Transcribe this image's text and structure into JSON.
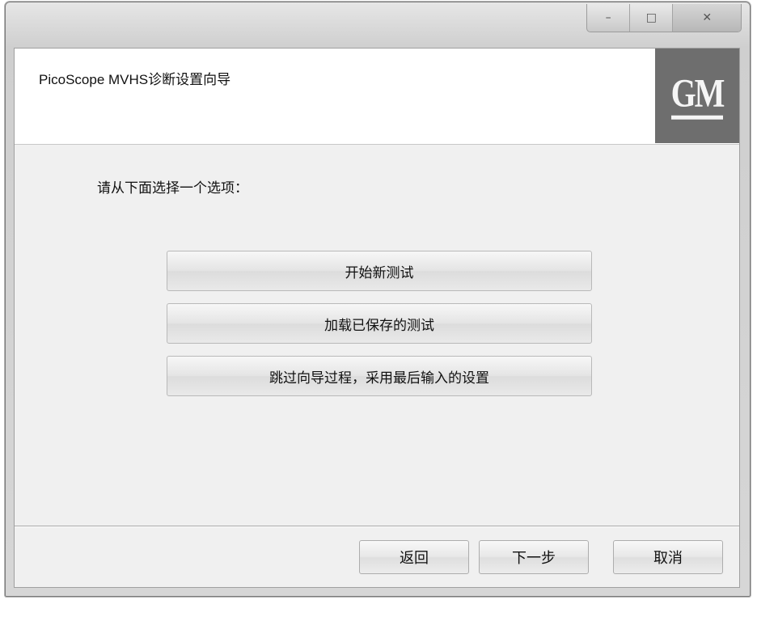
{
  "window": {
    "title": "PicoScope MVHS诊断设置向导"
  },
  "header": {
    "title": "PicoScope MVHS诊断设置向导",
    "logo_text": "GM"
  },
  "main": {
    "prompt": "请从下面选择一个选项：",
    "options": [
      {
        "label": "开始新测试"
      },
      {
        "label": "加载已保存的测试"
      },
      {
        "label": "跳过向导过程，采用最后输入的设置"
      }
    ]
  },
  "footer": {
    "back_label": "返回",
    "next_label": "下一步",
    "cancel_label": "取消"
  },
  "icons": {
    "minimize": "minimize-icon",
    "maximize": "maximize-icon",
    "close": "close-icon"
  }
}
